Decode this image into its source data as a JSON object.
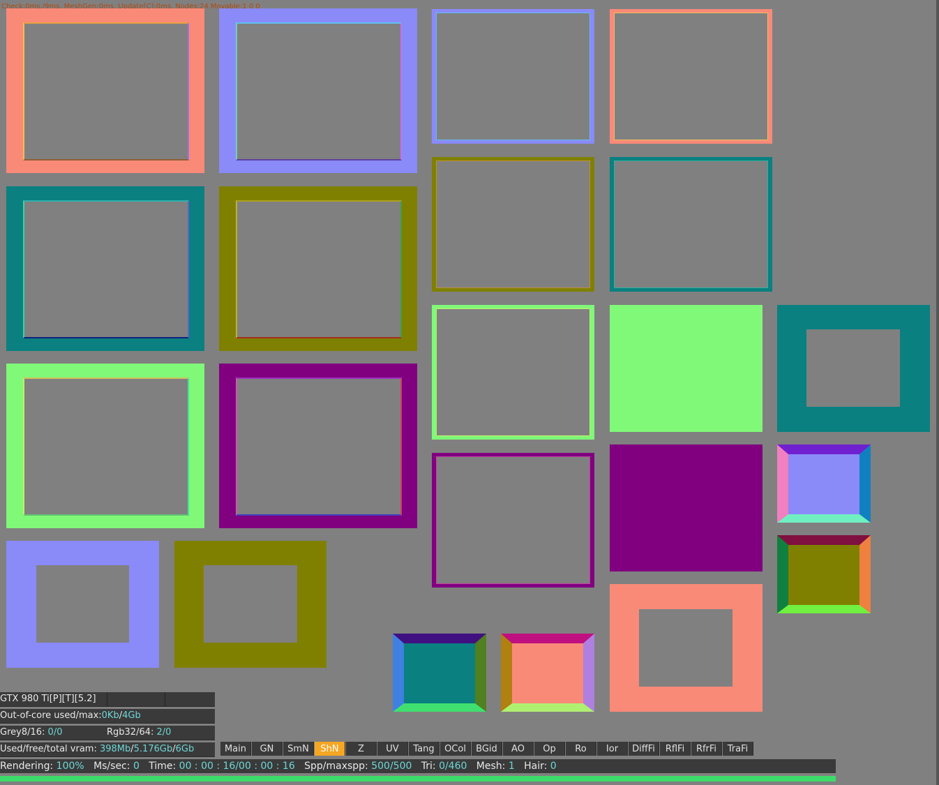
{
  "debug_text": "Check:0ms./9ms. MeshGen:0ms. Update[C]:0ms. Nodes:24 Movable:1  0 0",
  "colors": {
    "background": "#808080",
    "salmon": "#f98a78",
    "periwinkle": "#8a8af9",
    "teal": "#0a8080",
    "olive": "#808000",
    "lime": "#80f878",
    "purple": "#800080",
    "accent": "#f5a623",
    "value_text": "#6fd6d6",
    "progress": "#3ddc6a"
  },
  "gpu_panel": {
    "device": "GTX 980 Ti[P][T][5.2]",
    "out_of_core_label": "Out-of-core used/max:",
    "out_of_core_used": "0Kb",
    "out_of_core_max": "4Gb",
    "grey_label": "Grey8/16:",
    "grey_value": "0/0",
    "rgb_label": "Rgb32/64:",
    "rgb_value": "2/0",
    "vram_label": "Used/free/total vram:",
    "vram_used": "398Mb",
    "vram_free": "5.176Gb",
    "vram_total": "6Gb"
  },
  "render_tabs": [
    "Main",
    "GN",
    "SmN",
    "ShN",
    "Z",
    "UV",
    "Tang",
    "OCol",
    "BGid",
    "AO",
    "Op",
    "Ro",
    "Ior",
    "DiffFi",
    "RflFi",
    "RfrFi",
    "TraFi"
  ],
  "active_tab": "ShN",
  "status_bar": {
    "rendering_label": "Rendering:",
    "rendering_value": "100%",
    "ms_label": "Ms/sec:",
    "ms_value": "0",
    "time_label": "Time:",
    "time_value": "00 : 00 : 16/00 : 00 : 16",
    "spp_label": "Spp/maxspp:",
    "spp_value": "500/500",
    "tri_label": "Tri:",
    "tri_value": "0/460",
    "mesh_label": "Mesh:",
    "mesh_value": "1",
    "hair_label": "Hair:",
    "hair_value": "0",
    "progress": 1.0
  }
}
